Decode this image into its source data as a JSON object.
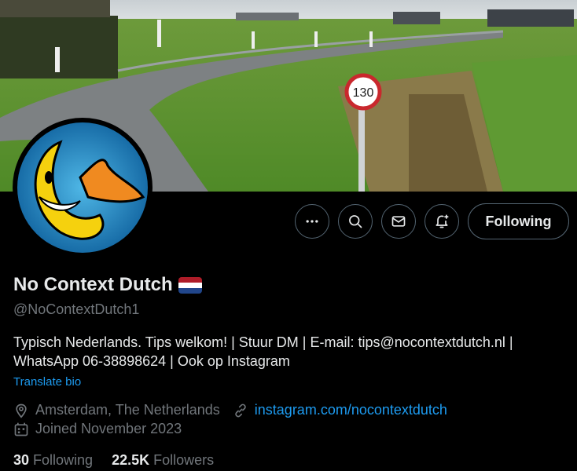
{
  "profile": {
    "display_name": "No Context Dutch",
    "handle": "@NoContextDutch1",
    "bio": "Typisch Nederlands. Tips welkom! | Stuur DM | E-mail: tips@nocontextdutch.nl | WhatsApp 06-38898624 | Ook op Instagram",
    "translate_label": "Translate bio",
    "location": "Amsterdam, The Netherlands",
    "website": "instagram.com/nocontextdutch",
    "joined": "Joined November 2023",
    "following_count": "30",
    "following_label": "Following",
    "followers_count": "22.5K",
    "followers_label": "Followers",
    "flag_icon": "netherlands-flag-icon"
  },
  "banner": {
    "speed_sign_text": "130"
  },
  "actions": {
    "more_icon": "more-icon",
    "search_icon": "search-icon",
    "message_icon": "envelope-icon",
    "notify_icon": "bell-plus-icon",
    "follow_label": "Following"
  },
  "colors": {
    "background": "#000000",
    "text_primary": "#e7e9ea",
    "text_secondary": "#71767b",
    "link": "#1d9bf0",
    "border": "#536471"
  }
}
